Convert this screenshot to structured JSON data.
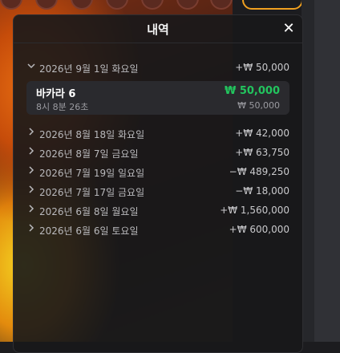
{
  "panel": {
    "title": "내역",
    "close_label": "✕"
  },
  "colors": {
    "accent_win": "#22c55e",
    "button_border": "#f0a020"
  },
  "history": {
    "expanded": {
      "date": "2026년 9월 1일 화요일",
      "total": "+₩ 50,000",
      "game": "바카라 6",
      "win": "₩ 50,000",
      "time": "8시 8분 26초",
      "bet": "₩ 50,000"
    },
    "days": [
      {
        "date": "2026년 8월 18일 화요일",
        "total": "+₩ 42,000"
      },
      {
        "date": "2026년 8월 7일 금요일",
        "total": "+₩ 63,750"
      },
      {
        "date": "2026년 7월 19일 일요일",
        "total": "−₩ 489,250"
      },
      {
        "date": "2026년 7월 17일 금요일",
        "total": "−₩ 18,000"
      },
      {
        "date": "2026년 6월 8일 월요일",
        "total": "+₩ 1,560,000"
      },
      {
        "date": "2026년 6월 6일 토요일",
        "total": "+₩ 600,000"
      }
    ]
  }
}
